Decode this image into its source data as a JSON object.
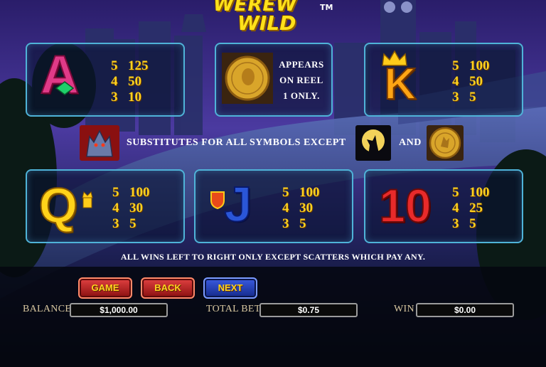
{
  "logo": {
    "line1": "WEREW",
    "line2": "WILD",
    "tm": "TM"
  },
  "paytable": {
    "ace": {
      "symbol": "A",
      "pays": [
        {
          "count": "5",
          "value": "125"
        },
        {
          "count": "4",
          "value": "50"
        },
        {
          "count": "3",
          "value": "10"
        }
      ]
    },
    "scatter": {
      "line1": "APPEARS",
      "line2": "ON REEL",
      "line3": "1 ONLY."
    },
    "king": {
      "symbol": "K",
      "pays": [
        {
          "count": "5",
          "value": "100"
        },
        {
          "count": "4",
          "value": "50"
        },
        {
          "count": "3",
          "value": "5"
        }
      ]
    },
    "queen": {
      "symbol": "Q",
      "pays": [
        {
          "count": "5",
          "value": "100"
        },
        {
          "count": "4",
          "value": "30"
        },
        {
          "count": "3",
          "value": "5"
        }
      ]
    },
    "jack": {
      "symbol": "J",
      "pays": [
        {
          "count": "5",
          "value": "100"
        },
        {
          "count": "4",
          "value": "30"
        },
        {
          "count": "3",
          "value": "5"
        }
      ]
    },
    "ten": {
      "symbol": "10",
      "pays": [
        {
          "count": "5",
          "value": "100"
        },
        {
          "count": "4",
          "value": "25"
        },
        {
          "count": "3",
          "value": "5"
        }
      ]
    }
  },
  "wild": {
    "text": "SUBSTITUTES FOR ALL SYMBOLS EXCEPT",
    "and": "AND"
  },
  "rules": "ALL WINS LEFT TO RIGHT ONLY EXCEPT SCATTERS WHICH PAY ANY.",
  "buttons": {
    "game": "GAME",
    "back": "BACK",
    "next": "NEXT"
  },
  "status": {
    "balance_label": "BALANCE",
    "balance_value": "$1,000.00",
    "totalbet_label": "TOTAL BET",
    "totalbet_value": "$0.75",
    "win_label": "WIN",
    "win_value": "$0.00"
  },
  "colors": {
    "panel_border": "#4fb3d8",
    "payout_text": "#ffd21f",
    "sky": "#3a2a8a"
  }
}
